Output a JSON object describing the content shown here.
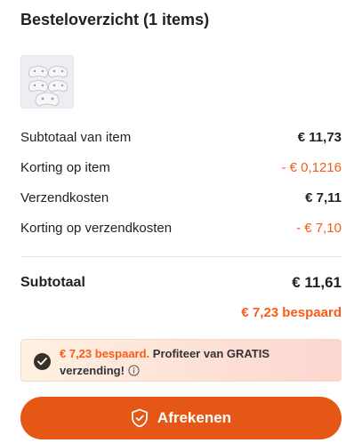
{
  "summary": {
    "title": "Besteloverzicht (1 items)"
  },
  "item": {
    "thumbnail_icon": "controller-thumbnail"
  },
  "rows": [
    {
      "label": "Subtotaal van item",
      "value": "€ 11,73",
      "discount": false
    },
    {
      "label": "Korting op item",
      "value": "- € 0,1216",
      "discount": true
    },
    {
      "label": "Verzendkosten",
      "value": "€ 7,11",
      "discount": false
    },
    {
      "label": "Korting op verzendkosten",
      "value": "- € 7,10",
      "discount": true
    }
  ],
  "subtotal": {
    "label": "Subtotaal",
    "value": "€ 11,61",
    "saved": "€ 7,23 bespaard"
  },
  "promo": {
    "saved_text": "€ 7,23 bespaard.",
    "message": " Profiteer van GRATIS verzending!",
    "icon": "check-circle-icon",
    "info_icon": "info-icon"
  },
  "checkout": {
    "label": "Afrekenen",
    "icon": "shield-check-icon"
  },
  "colors": {
    "accent": "#fb5a18",
    "button": "#e45715"
  }
}
